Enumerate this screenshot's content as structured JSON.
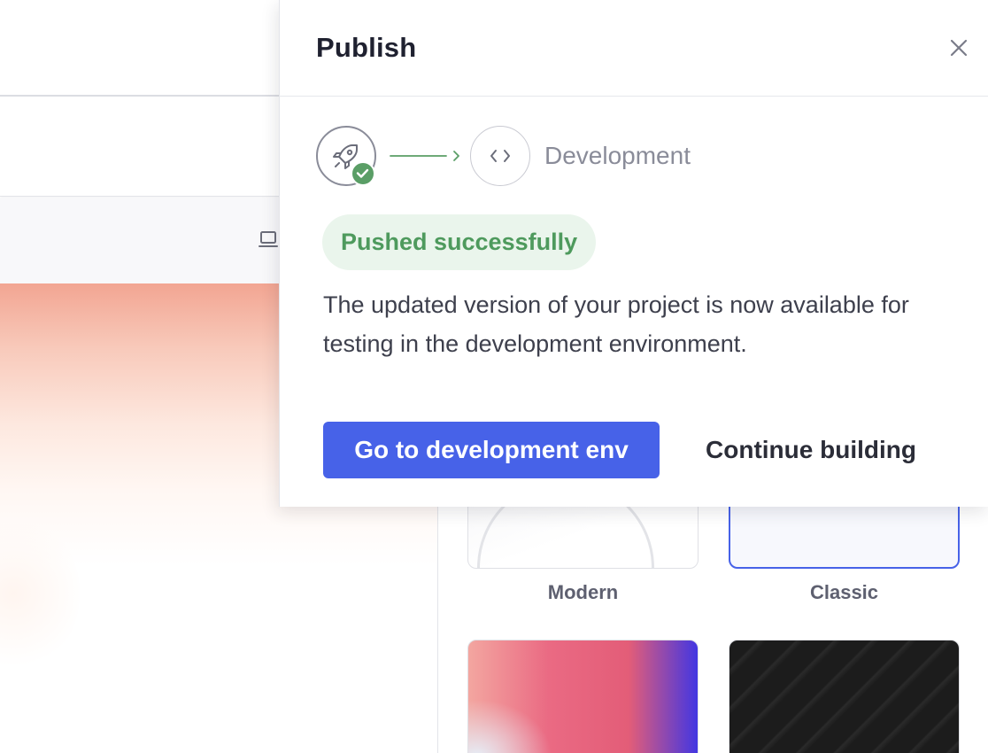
{
  "publish_dialog": {
    "title": "Publish",
    "close_icon": "close-icon",
    "steps": {
      "source_icon": "rocket-icon",
      "source_status_icon": "checkmark-icon",
      "target_icon": "code-brackets-icon",
      "target_label": "Development"
    },
    "status": {
      "label": "Pushed successfully",
      "color": "#4e9a5d"
    },
    "description": "The updated version of your project is now available for testing in the development environment.",
    "primary_action": "Go to development env",
    "secondary_action": "Continue building"
  },
  "background": {
    "toolbar_icon": "desktop-device-icon",
    "themes": [
      {
        "label": "Modern",
        "selected": false
      },
      {
        "label": "Classic",
        "selected": true
      }
    ]
  },
  "colors": {
    "accent": "#4762e8",
    "success": "#5a9e66",
    "success_bg": "#eaf5ec"
  }
}
